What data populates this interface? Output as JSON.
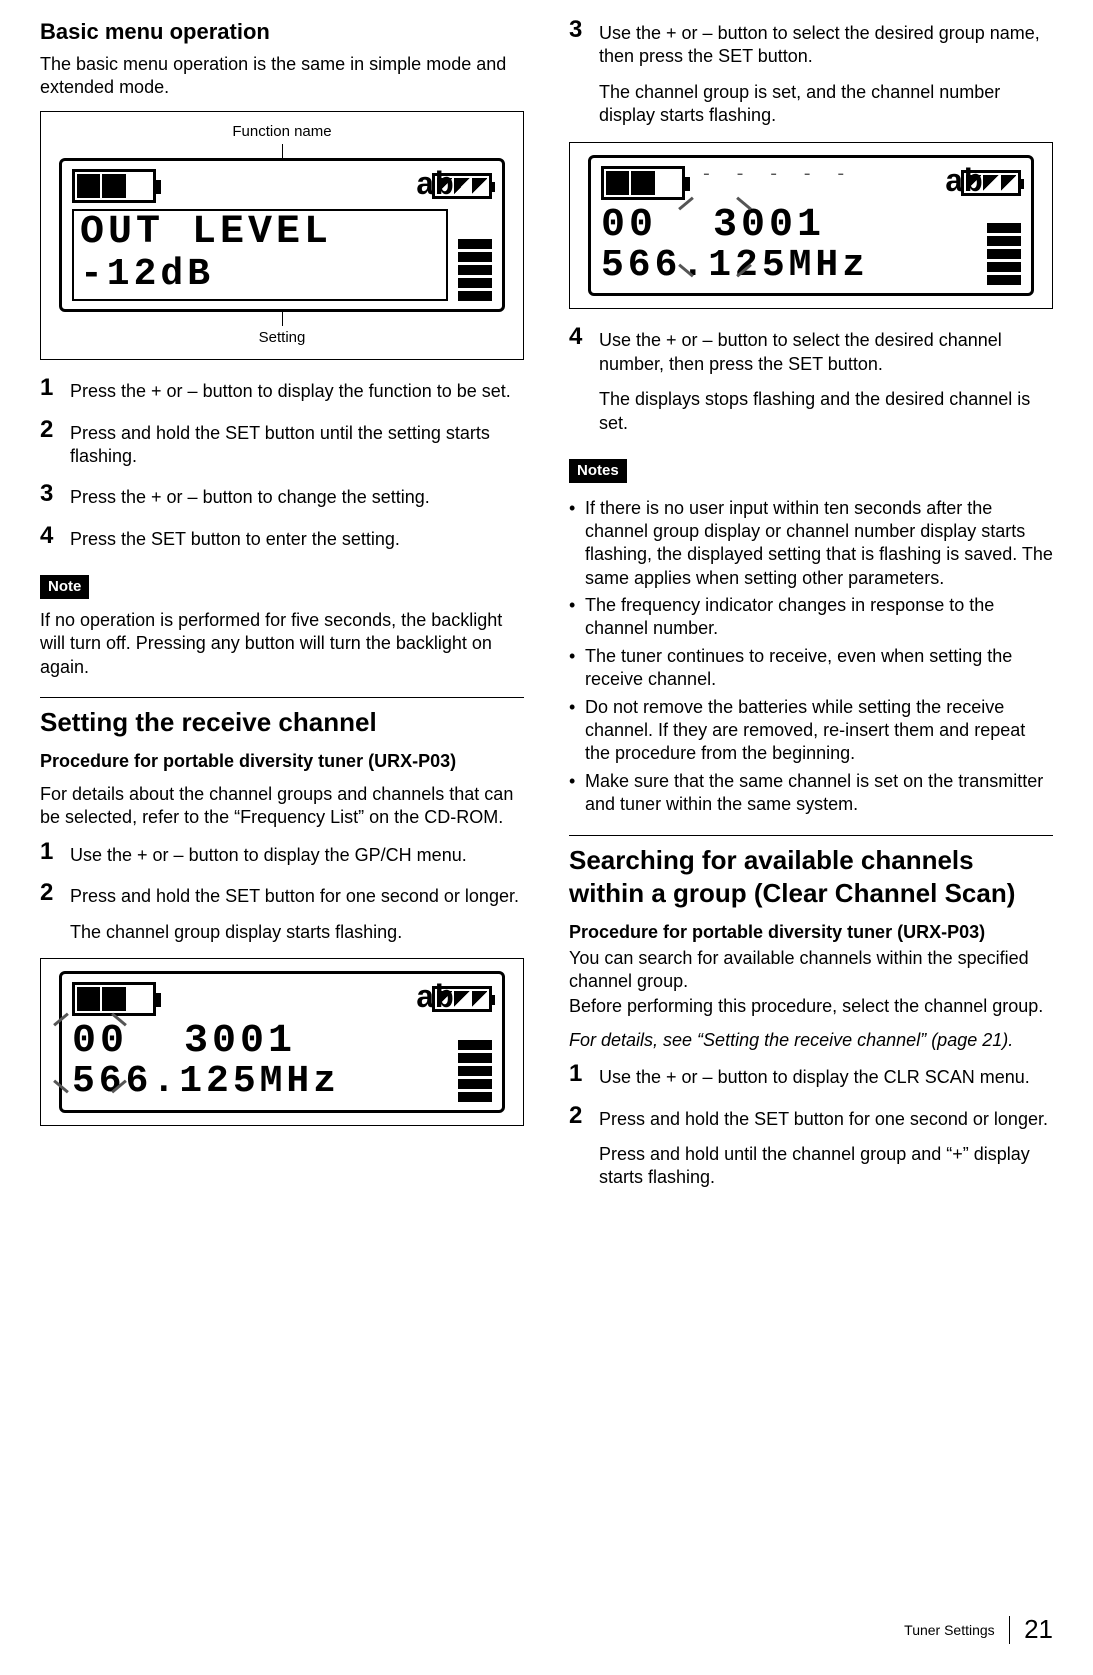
{
  "col1": {
    "h_basic": "Basic menu operation",
    "basic_intro": "The basic menu operation is the same in simple mode and extended mode.",
    "fig1": {
      "label_top": "Function name",
      "label_bottom": "Setting",
      "line1": "OUT LEVEL",
      "line2": "-12dB",
      "ab": "ab"
    },
    "steps1": [
      "Press the + or – button to display the function to be set.",
      "Press and hold the SET button until the setting starts flashing.",
      "Press the + or – button to change the setting.",
      "Press the SET button to enter the setting."
    ],
    "note_label": "Note",
    "note_text": "If no operation is performed for five seconds, the backlight will turn off. Pressing any button will turn the backlight on again.",
    "h_setting": "Setting the receive channel",
    "proc_head": "Procedure for portable diversity tuner (URX-P03)",
    "proc_intro": "For details about the channel groups and channels that can be selected, refer to the “Frequency List” on the CD-ROM.",
    "steps2": {
      "s1": "Use the + or – button to display the GP/CH menu.",
      "s2": "Press and hold the SET button for one second or longer.",
      "s2_sub": "The channel group display starts flashing."
    },
    "fig2": {
      "group": "00",
      "chan": "3001",
      "freq": "566.125MHz",
      "ab": "ab"
    }
  },
  "col2": {
    "step3": "Use the + or – button to select the desired group name, then press the SET button.",
    "step3_sub": "The channel group is set, and the channel number display starts flashing.",
    "fig3": {
      "group": "00",
      "chan": "3001",
      "freq": "566.125MHz",
      "ab": "ab"
    },
    "step4": "Use the + or – button to select the desired channel number, then press the SET button.",
    "step4_sub": "The displays stops flashing and the desired channel is set.",
    "notes_label": "Notes",
    "notes": [
      "If there is no user input within ten seconds after the channel group display or channel number display starts flashing, the displayed setting that is flashing is saved. The same applies when setting other parameters.",
      "The frequency indicator changes in response to the channel number.",
      "The tuner continues to receive, even when setting the receive channel.",
      "Do not remove the batteries while setting the receive channel. If they are removed, re-insert them and repeat the procedure from the beginning.",
      "Make sure that the same channel is set on the transmitter and tuner within the same system."
    ],
    "h_search": "Searching for available channels within a group (Clear Channel Scan)",
    "proc_head": "Procedure for portable diversity tuner (URX-P03)",
    "proc_p1": "You can search for available channels within the specified channel group.",
    "proc_p2": "Before performing this procedure, select the channel group.",
    "proc_ref": "For details, see “Setting the receive channel” (page 21).",
    "steps": {
      "s1": "Use the + or – button to display the CLR SCAN menu.",
      "s2": "Press and hold the SET button for one second or longer.",
      "s2_sub": "Press and hold until the channel group and “+” display starts flashing."
    }
  },
  "footer": {
    "title": "Tuner Settings",
    "page": "21"
  }
}
